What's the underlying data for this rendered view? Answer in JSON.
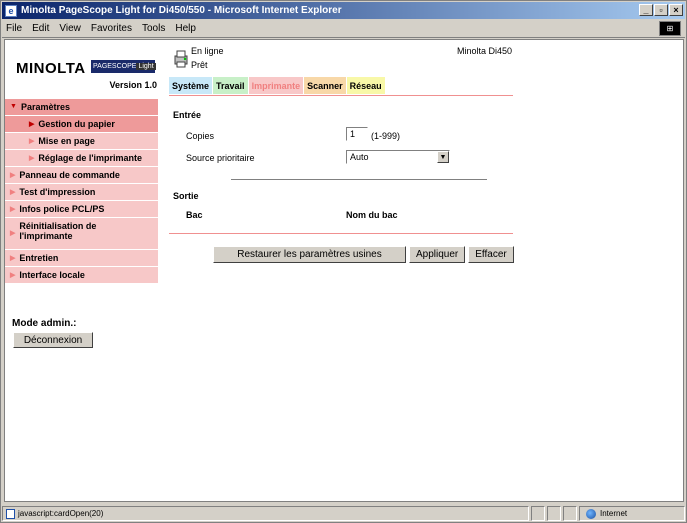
{
  "window": {
    "title": "Minolta PageScope Light for Di450/550 - Microsoft Internet Explorer"
  },
  "menu": [
    "File",
    "Edit",
    "View",
    "Favorites",
    "Tools",
    "Help"
  ],
  "logo": {
    "brand": "MINOLTA",
    "product_left": "PAGESCOPE",
    "product_right": "Light",
    "version": "Version 1.0"
  },
  "nav": {
    "params": "Paramètres",
    "paper": "Gestion du papier",
    "layout": "Mise en page",
    "printer_settings": "Réglage de l'imprimante",
    "panel": "Panneau de commande",
    "test": "Test d'impression",
    "fonts": "Infos police PCL/PS",
    "reset": "Réinitialisation de l'imprimante",
    "maintenance": "Entretien",
    "interface": "Interface locale"
  },
  "admin": {
    "label": "Mode admin.:",
    "logout": "Déconnexion"
  },
  "status": {
    "online": "En ligne",
    "ready": "Prêt",
    "device": "Minolta Di450"
  },
  "tabs": {
    "system": "Système",
    "work": "Travail",
    "printer": "Imprimante",
    "scanner": "Scanner",
    "network": "Réseau"
  },
  "form": {
    "input_section": "Entrée",
    "copies_label": "Copies",
    "copies_value": "1",
    "copies_range": "(1-999)",
    "source_label": "Source prioritaire",
    "source_value": "Auto",
    "output_section": "Sortie",
    "col_tray": "Bac",
    "col_tray_name": "Nom du bac"
  },
  "actions": {
    "restore": "Restaurer les paramètres usines",
    "apply": "Appliquer",
    "clear": "Effacer"
  },
  "statusbar": {
    "text": "javascript:cardOpen(20)",
    "zone": "Internet"
  }
}
